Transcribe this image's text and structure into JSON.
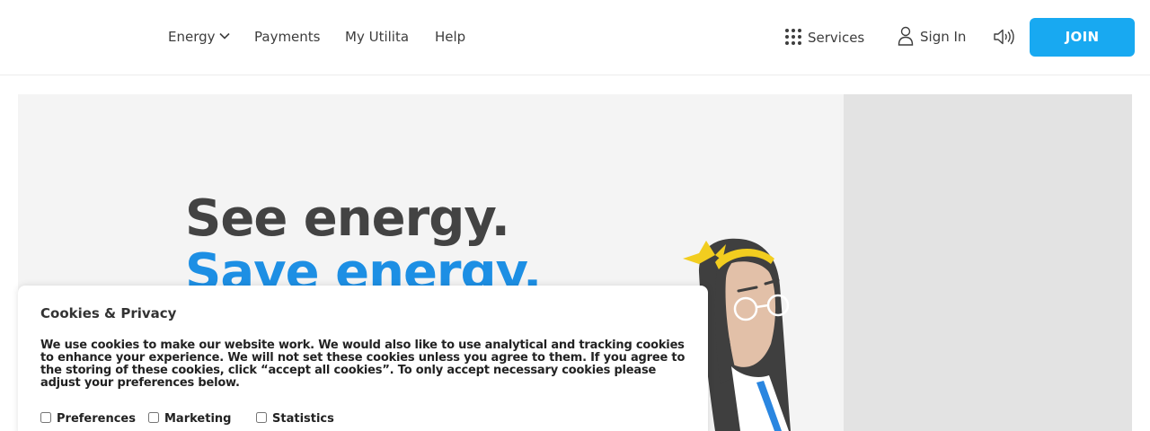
{
  "header": {
    "nav": [
      {
        "label": "Energy"
      },
      {
        "label": "Payments"
      },
      {
        "label": "My Utilita"
      },
      {
        "label": "Help"
      }
    ],
    "services_label": "Services",
    "signin_label": "Sign In",
    "join_label": "JOIN"
  },
  "hero": {
    "headline_line1": "See energy.",
    "headline_line2": "Save energy."
  },
  "cookie": {
    "title": "Cookies & Privacy",
    "body": "We use cookies to make our website work. We would also like to use analytical and tracking cookies to enhance your experience. We will not set these cookies unless you agree to them. If you agree to the storing of these cookies, click “accept all cookies”. To only accept necessary cookies please adjust your preferences below.",
    "options": [
      {
        "label": "Preferences"
      },
      {
        "label": "Marketing"
      },
      {
        "label": "Statistics"
      }
    ]
  },
  "colors": {
    "accent": "#18a9f1",
    "headline_dark": "#434343",
    "headline_blue": "#1d8fe4",
    "hero_bg": "#f4f4f4",
    "hero_side_bg": "#e3e3e3"
  },
  "icons": [
    "chevron-down-icon",
    "grid-icon",
    "user-icon",
    "speaker-icon"
  ]
}
